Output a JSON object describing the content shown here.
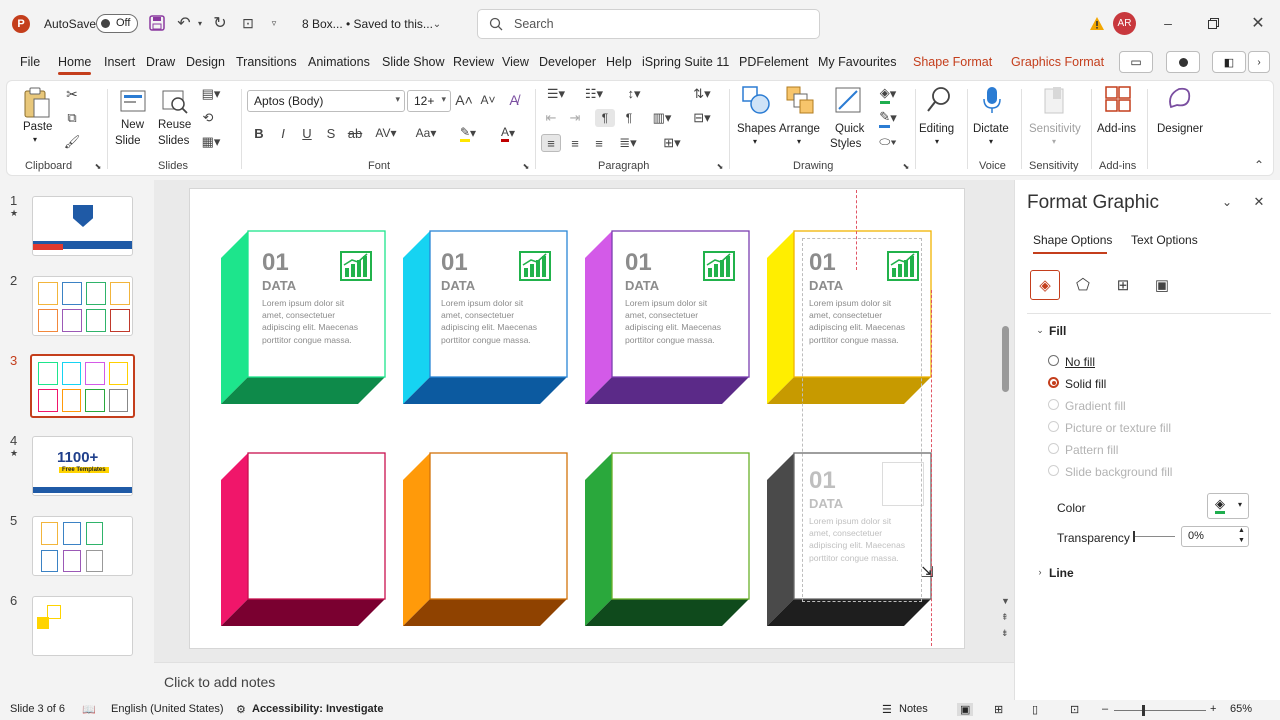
{
  "titlebar": {
    "autosave_label": "AutoSave",
    "autosave_state": "Off",
    "doc_title": "8 Box... • Saved to this...",
    "search_placeholder": "Search",
    "avatar_initials": "AR"
  },
  "tabs": [
    "File",
    "Home",
    "Insert",
    "Draw",
    "Design",
    "Transitions",
    "Animations",
    "Slide Show",
    "Review",
    "View",
    "Developer",
    "Help",
    "iSpring Suite 11",
    "PDFelement",
    "My Favourites",
    "Shape Format",
    "Graphics Format"
  ],
  "ribbon": {
    "groups": {
      "clipboard": "Clipboard",
      "slides": "Slides",
      "font": "Font",
      "paragraph": "Paragraph",
      "drawing": "Drawing",
      "voice": "Voice",
      "sensitivity": "Sensitivity",
      "addins": "Add-ins"
    },
    "paste": "Paste",
    "new_slide_1": "New",
    "new_slide_2": "Slide",
    "reuse_1": "Reuse",
    "reuse_2": "Slides",
    "font_name": "Aptos (Body)",
    "font_size": "12+",
    "shapes": "Shapes",
    "arrange": "Arrange",
    "quick_styles_1": "Quick",
    "quick_styles_2": "Styles",
    "editing": "Editing",
    "dictate": "Dictate",
    "sensitivity_btn": "Sensitivity",
    "addins_btn": "Add-ins",
    "designer": "Designer"
  },
  "thumbnails": [
    "1",
    "2",
    "3",
    "4",
    "5",
    "6"
  ],
  "thumb4_text": "1100+",
  "thumb4_sub": "Free Templates",
  "slide": {
    "box_number": "01",
    "box_title": "DATA",
    "box_text": [
      "Lorem ipsum dolor sit",
      "amet, consectetuer",
      "adipiscing elit. Maecenas",
      "porttitor congue massa."
    ],
    "colors": {
      "green": "#1de58c",
      "cyan": "#16d3f2",
      "purple": "#d35ae8",
      "yellow": "#ffee00",
      "pink": "#f0166a",
      "orange": "#ff9a0a",
      "darkgreen": "#2aa83c",
      "gray": "#4a4a4a"
    }
  },
  "notes_placeholder": "Click to add notes",
  "format_pane": {
    "title": "Format Graphic",
    "tab_shape": "Shape Options",
    "tab_text": "Text Options",
    "fill_section": "Fill",
    "options": [
      "No fill",
      "Solid fill",
      "Gradient fill",
      "Picture or texture fill",
      "Pattern fill",
      "Slide background fill"
    ],
    "color_label": "Color",
    "transparency_label": "Transparency",
    "transparency_value": "0%",
    "line_section": "Line"
  },
  "status": {
    "slide_info": "Slide 3 of 6",
    "language": "English (United States)",
    "accessibility": "Accessibility: Investigate",
    "notes": "Notes",
    "zoom": "65%"
  }
}
